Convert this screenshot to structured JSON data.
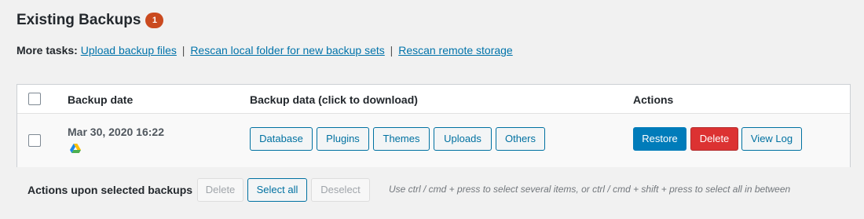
{
  "heading": {
    "title": "Existing Backups",
    "count": "1"
  },
  "more_tasks": {
    "label": "More tasks:",
    "links": [
      "Upload backup files",
      "Rescan local folder for new backup sets",
      "Rescan remote storage"
    ],
    "separator": "|"
  },
  "table": {
    "columns": {
      "date": "Backup date",
      "data": "Backup data (click to download)",
      "actions": "Actions"
    },
    "rows": [
      {
        "date": "Mar 30, 2020 16:22",
        "storage_icon": "google-drive-icon",
        "data_buttons": [
          "Database",
          "Plugins",
          "Themes",
          "Uploads",
          "Others"
        ],
        "actions": {
          "restore": "Restore",
          "delete": "Delete",
          "view_log": "View Log"
        }
      }
    ]
  },
  "bulk": {
    "label": "Actions upon selected backups",
    "delete": "Delete",
    "select_all": "Select all",
    "deselect": "Deselect",
    "hint": "Use ctrl / cmd + press to select several items, or ctrl / cmd + shift + press to select all in between"
  },
  "colors": {
    "link": "#0073aa",
    "primary": "#007cba",
    "danger": "#dc3232",
    "badge": "#ca4a1f"
  }
}
